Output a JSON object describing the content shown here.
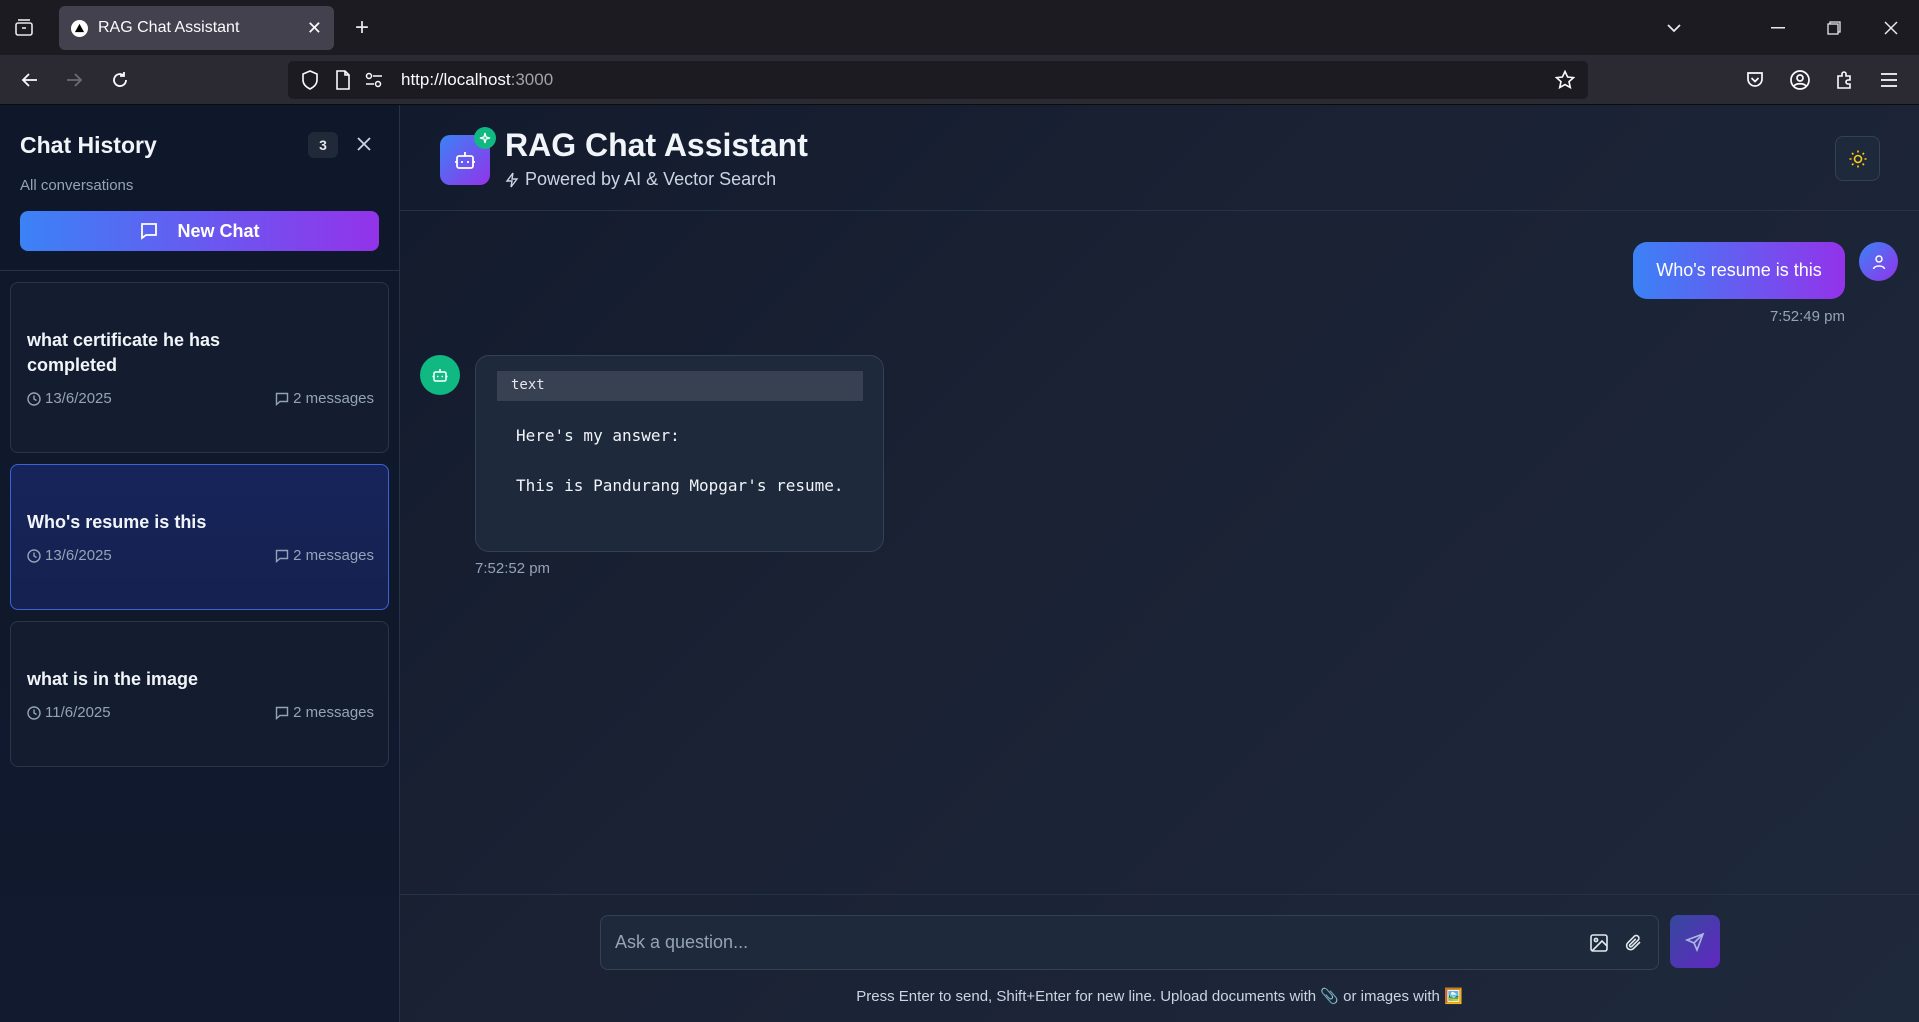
{
  "browser": {
    "tab_title": "RAG Chat Assistant",
    "url_host": "http://localhost",
    "url_port": ":3000"
  },
  "sidebar": {
    "title": "Chat History",
    "count": "3",
    "subtitle": "All conversations",
    "new_chat_label": "New Chat",
    "conversations": [
      {
        "title": "what certificate he has completed",
        "date": "13/6/2025",
        "messages": "2 messages",
        "active": false
      },
      {
        "title": "Who's resume is this",
        "date": "13/6/2025",
        "messages": "2 messages",
        "active": true
      },
      {
        "title": "what is in the image",
        "date": "11/6/2025",
        "messages": "2 messages",
        "active": false
      }
    ]
  },
  "header": {
    "title": "RAG Chat Assistant",
    "subtitle": "Powered by AI & Vector Search"
  },
  "chat": {
    "user_message": "Who's resume is this",
    "user_time": "7:52:49 pm",
    "bot_code_lang": "text",
    "bot_line_1": "Here's my answer:",
    "bot_line_2": "This is Pandurang Mopgar's resume.",
    "bot_time": "7:52:52 pm"
  },
  "composer": {
    "placeholder": "Ask a question...",
    "hint": "Press Enter to send, Shift+Enter for new line. Upload documents with 📎 or images with 🖼️"
  },
  "colors": {
    "accent_start": "#3b82f6",
    "accent_end": "#9333ea",
    "bot_green": "#10b981",
    "background": "#0f172a"
  }
}
